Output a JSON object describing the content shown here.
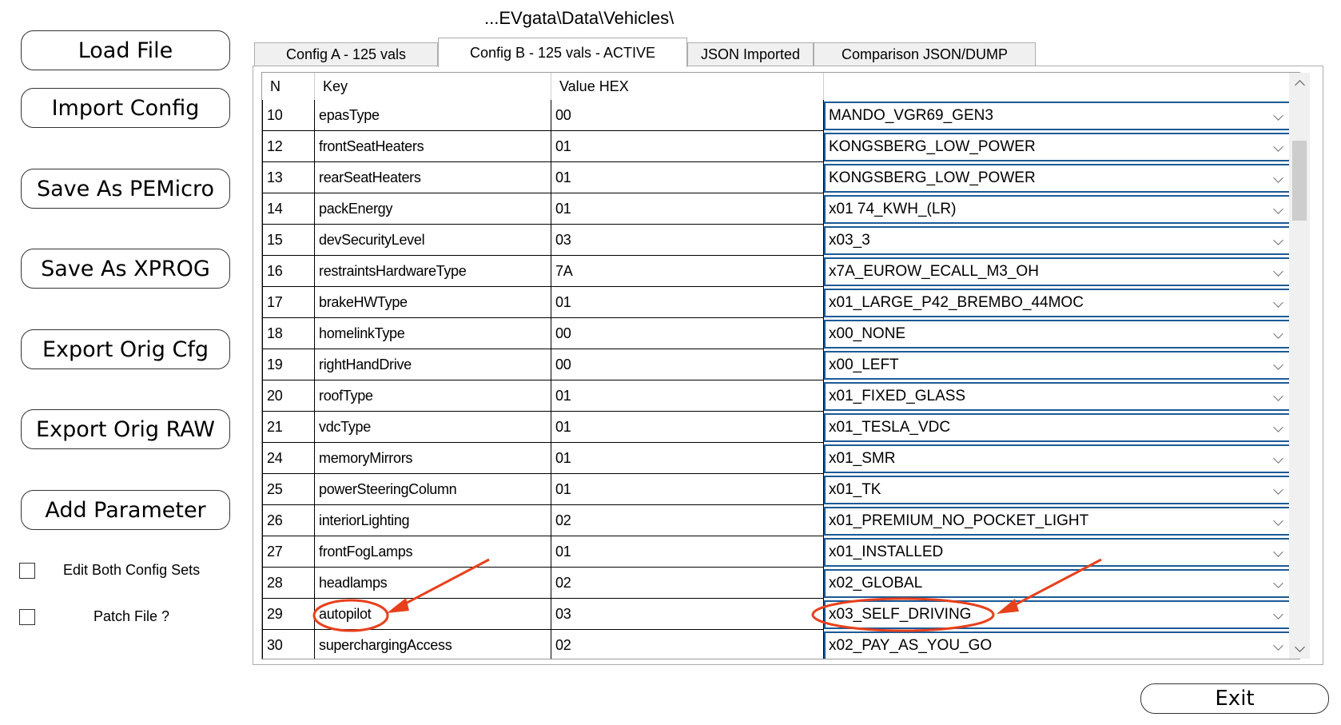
{
  "path": "...EVgata\\Data\\Vehicles\\",
  "sidebar": {
    "buttons": [
      {
        "label": "Load File"
      },
      {
        "label": "Import Config"
      },
      {
        "label": "Save As PEMicro"
      },
      {
        "label": "Save As XPROG"
      },
      {
        "label": "Export Orig Cfg"
      },
      {
        "label": "Export Orig RAW"
      },
      {
        "label": "Add Parameter"
      }
    ],
    "checkboxes": [
      {
        "label": "Edit Both Config Sets",
        "checked": false
      },
      {
        "label": "Patch File ?",
        "checked": false
      }
    ]
  },
  "tabs": [
    {
      "label": "Config A - 125 vals",
      "active": false
    },
    {
      "label": "Config B - 125 vals - ACTIVE",
      "active": true
    },
    {
      "label": "JSON Imported",
      "active": false
    },
    {
      "label": "Comparison JSON/DUMP",
      "active": false
    }
  ],
  "grid": {
    "headers": {
      "n": "N",
      "key": "Key",
      "value": "Value HEX",
      "decoded": ""
    },
    "rows": [
      {
        "n": "10",
        "key": "epasType",
        "hex": "00",
        "decoded": "MANDO_VGR69_GEN3"
      },
      {
        "n": "12",
        "key": "frontSeatHeaters",
        "hex": "01",
        "decoded": "KONGSBERG_LOW_POWER"
      },
      {
        "n": "13",
        "key": "rearSeatHeaters",
        "hex": "01",
        "decoded": "KONGSBERG_LOW_POWER"
      },
      {
        "n": "14",
        "key": "packEnergy",
        "hex": "01",
        "decoded": "x01 74_KWH_(LR)"
      },
      {
        "n": "15",
        "key": "devSecurityLevel",
        "hex": "03",
        "decoded": "x03_3"
      },
      {
        "n": "16",
        "key": "restraintsHardwareType",
        "hex": "7A",
        "decoded": "x7A_EUROW_ECALL_M3_OH"
      },
      {
        "n": "17",
        "key": "brakeHWType",
        "hex": "01",
        "decoded": "x01_LARGE_P42_BREMBO_44MOC"
      },
      {
        "n": "18",
        "key": "homelinkType",
        "hex": "00",
        "decoded": "x00_NONE"
      },
      {
        "n": "19",
        "key": "rightHandDrive",
        "hex": "00",
        "decoded": "x00_LEFT"
      },
      {
        "n": "20",
        "key": "roofType",
        "hex": "01",
        "decoded": "x01_FIXED_GLASS"
      },
      {
        "n": "21",
        "key": "vdcType",
        "hex": "01",
        "decoded": "x01_TESLA_VDC"
      },
      {
        "n": "24",
        "key": "memoryMirrors",
        "hex": "01",
        "decoded": "x01_SMR"
      },
      {
        "n": "25",
        "key": "powerSteeringColumn",
        "hex": "01",
        "decoded": "x01_TK"
      },
      {
        "n": "26",
        "key": "interiorLighting",
        "hex": "02",
        "decoded": "x01_PREMIUM_NO_POCKET_LIGHT"
      },
      {
        "n": "27",
        "key": "frontFogLamps",
        "hex": "01",
        "decoded": "x01_INSTALLED"
      },
      {
        "n": "28",
        "key": "headlamps",
        "hex": "02",
        "decoded": "x02_GLOBAL"
      },
      {
        "n": "29",
        "key": "autopilot",
        "hex": "03",
        "decoded": "x03_SELF_DRIVING"
      },
      {
        "n": "30",
        "key": "superchargingAccess",
        "hex": "02",
        "decoded": "x02_PAY_AS_YOU_GO"
      }
    ]
  },
  "exit_label": "Exit",
  "colors": {
    "combo_border": "#1c5a96",
    "annotation": "#e8401c"
  },
  "icons": {
    "combo_dropdown": "chevron-down-icon",
    "scroll_up": "scroll-up-icon",
    "scroll_down": "scroll-down-icon"
  }
}
